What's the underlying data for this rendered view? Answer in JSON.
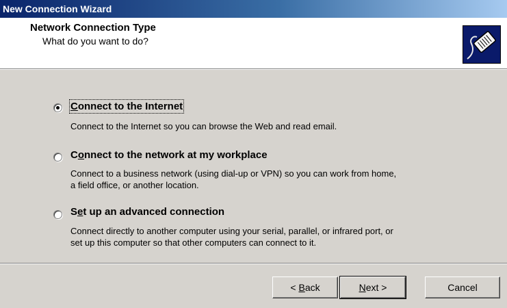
{
  "window": {
    "title": "New Connection Wizard"
  },
  "header": {
    "title": "Network Connection Type",
    "subtitle": "What do you want to do?",
    "logo_icon": "network-cable-plug-icon"
  },
  "options": [
    {
      "pre": "",
      "accel": "C",
      "post": "onnect to the Internet",
      "selected": true,
      "description": [
        "Connect to the Internet so you can browse the Web and read email."
      ]
    },
    {
      "pre": "C",
      "accel": "o",
      "post": "nnect to the network at my workplace",
      "selected": false,
      "description": [
        "Connect to a business network (using dial-up or VPN) so you can work from home,",
        "a field office, or another location."
      ]
    },
    {
      "pre": "S",
      "accel": "e",
      "post": "t up an advanced connection",
      "selected": false,
      "description": [
        "Connect directly to another computer using your serial, parallel, or infrared port, or",
        "set up this computer so that other computers can connect to it."
      ]
    }
  ],
  "buttons": {
    "back": {
      "pre": "< ",
      "accel": "B",
      "post": "ack"
    },
    "next": {
      "pre": "",
      "accel": "N",
      "post": "ext >"
    },
    "cancel": {
      "label": "Cancel"
    }
  }
}
